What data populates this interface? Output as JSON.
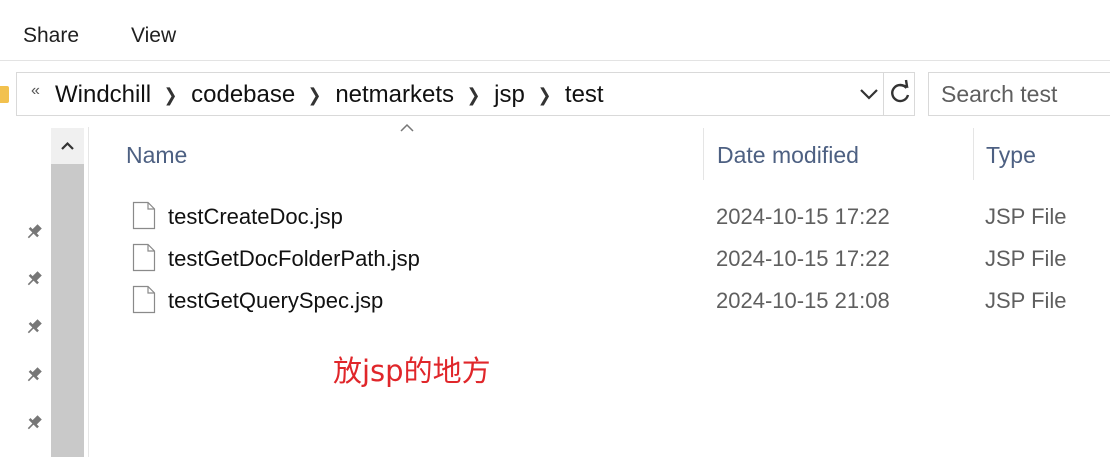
{
  "ribbon": {
    "tabs": [
      "Share",
      "View"
    ]
  },
  "address_bar": {
    "overflow_icon": "double-chevron-left-icon",
    "crumbs": [
      "Windchill",
      "codebase",
      "netmarkets",
      "jsp",
      "test"
    ],
    "separator_icon": "chevron-right-icon",
    "history_icon": "chevron-down-icon",
    "refresh_icon": "refresh-icon"
  },
  "search": {
    "placeholder": "Search test"
  },
  "nav_pane": {
    "pin_icon": "pin-icon",
    "pin_count": 5,
    "scroll_up_icon": "chevron-up-icon"
  },
  "columns": {
    "name": "Name",
    "date_modified": "Date modified",
    "type": "Type",
    "sort_icon": "sort-ascending-icon"
  },
  "files": [
    {
      "name": "testCreateDoc.jsp",
      "date": "2024-10-15 17:22",
      "type": "JSP File"
    },
    {
      "name": "testGetDocFolderPath.jsp",
      "date": "2024-10-15 17:22",
      "type": "JSP File"
    },
    {
      "name": "testGetQuerySpec.jsp",
      "date": "2024-10-15 21:08",
      "type": "JSP File"
    }
  ],
  "annotation": {
    "text": "放jsp的地方",
    "color": "#e0262a"
  },
  "colors": {
    "header_text": "#4d6082",
    "folder": "#f2c14e",
    "scrollbar_thumb": "#c9c9c9"
  }
}
